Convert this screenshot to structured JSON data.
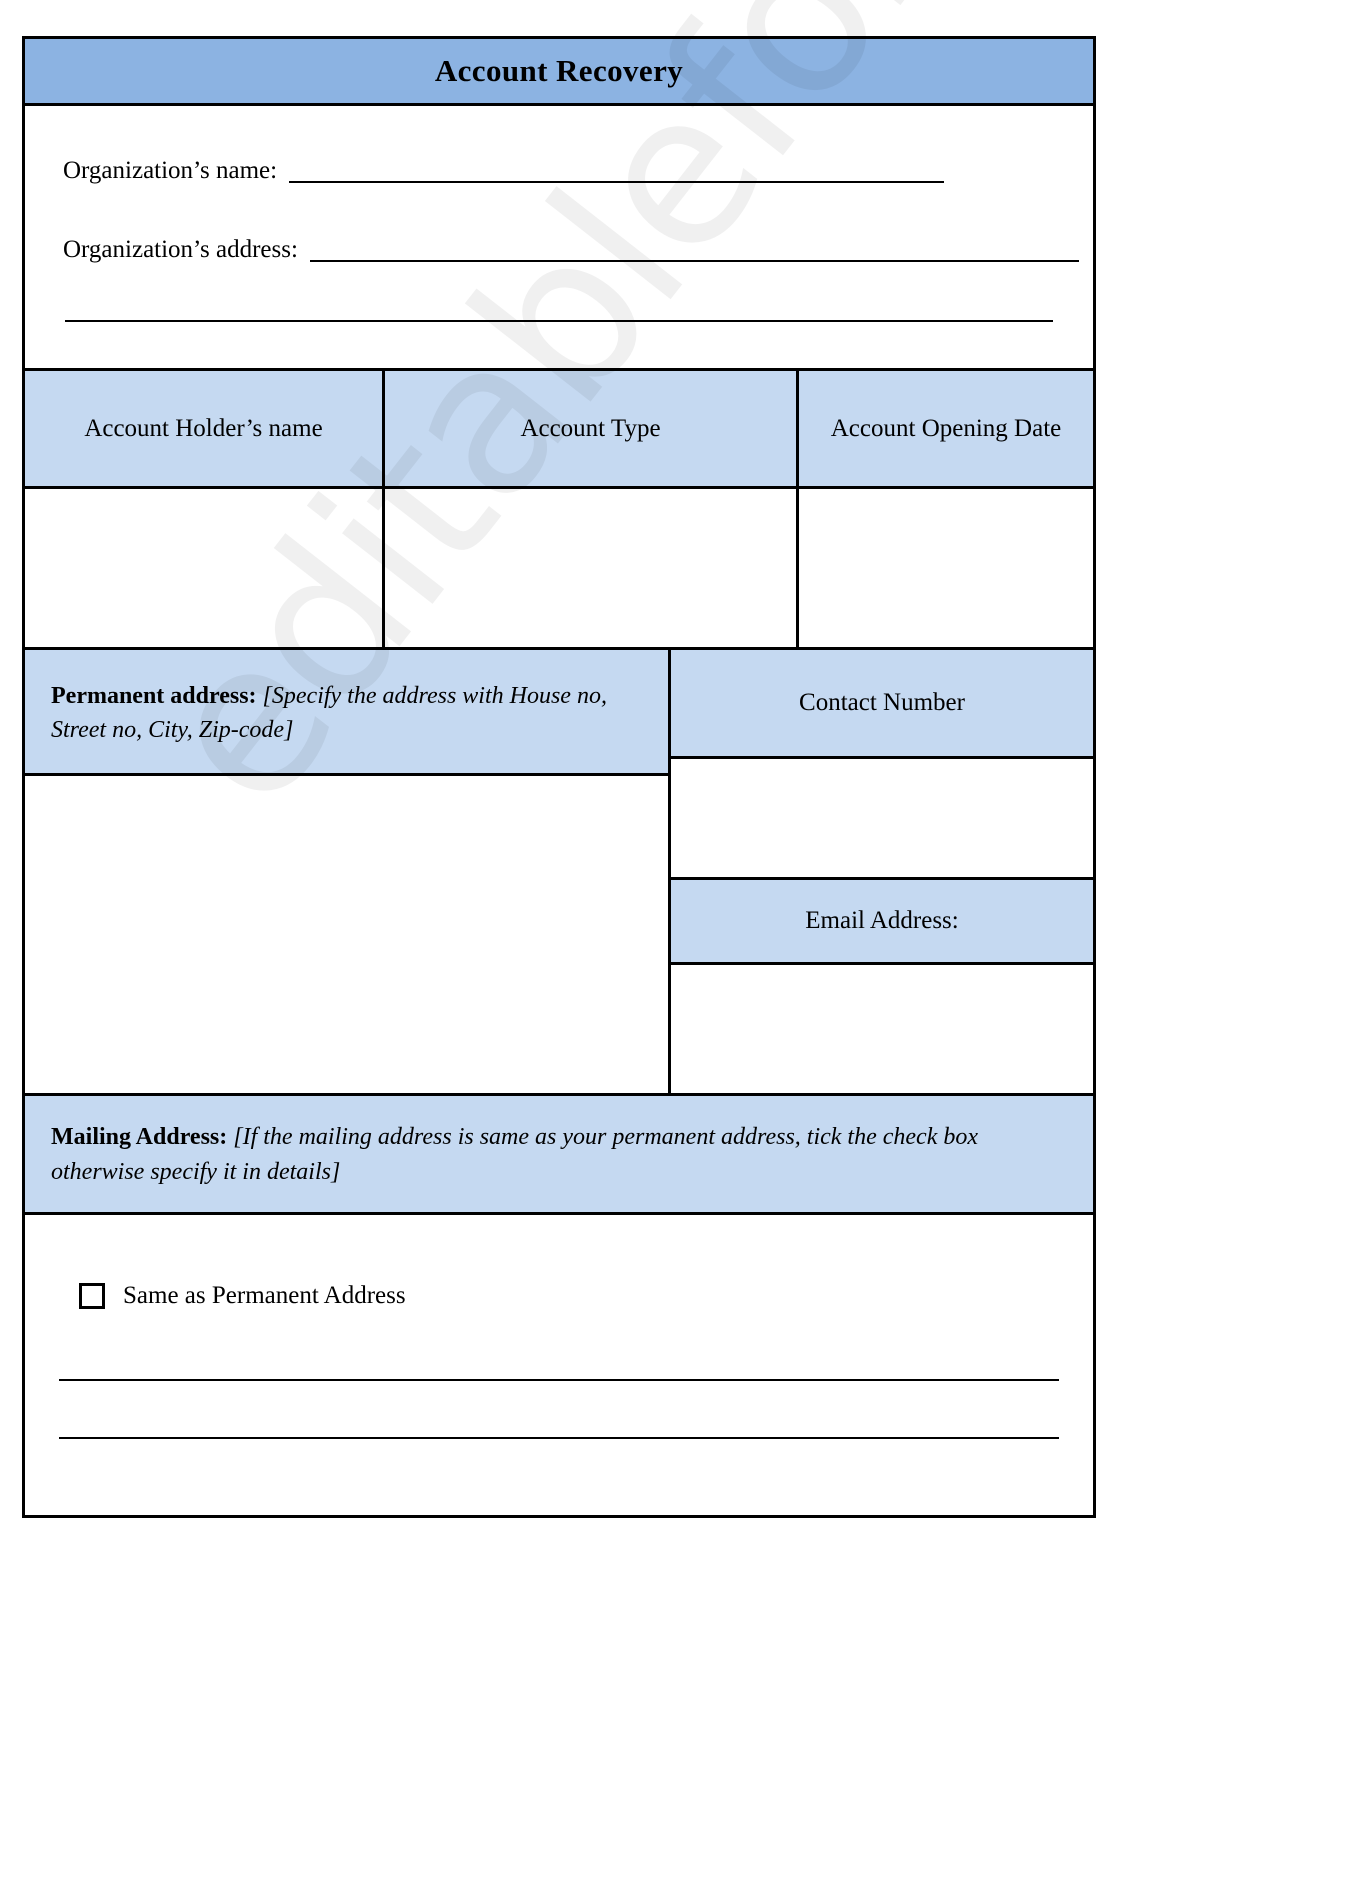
{
  "document": {
    "title": "Account Recovery",
    "watermark_text": "editableforms.com"
  },
  "colors": {
    "title_bar": "#8cb3e2",
    "section_header": "#c5d9f1",
    "border": "#000000",
    "page_background": "#ffffff"
  },
  "organization": {
    "name_label": "Organization’s name:",
    "name_value": "",
    "address_label": "Organization’s address:",
    "address_value": "",
    "address_value_line2": ""
  },
  "account_table": {
    "headers": [
      "Account Holder’s name",
      "Account Type",
      "Account Opening Date"
    ],
    "rows": [
      {
        "holder_name": "",
        "account_type": "",
        "opening_date": ""
      }
    ]
  },
  "permanent_address": {
    "label": "Permanent address:",
    "hint": "[Specify the address with House no, Street no, City, Zip-code]",
    "value": ""
  },
  "contact": {
    "number_label": "Contact Number",
    "number_value": "",
    "email_label": "Email Address:",
    "email_value": ""
  },
  "mailing_address": {
    "label": "Mailing Address:",
    "hint": "[If the mailing address is same as your permanent address, tick the check box otherwise specify it in details]",
    "checkbox_label": "Same as Permanent Address",
    "checkbox_checked": false,
    "line1_value": "",
    "line2_value": ""
  }
}
